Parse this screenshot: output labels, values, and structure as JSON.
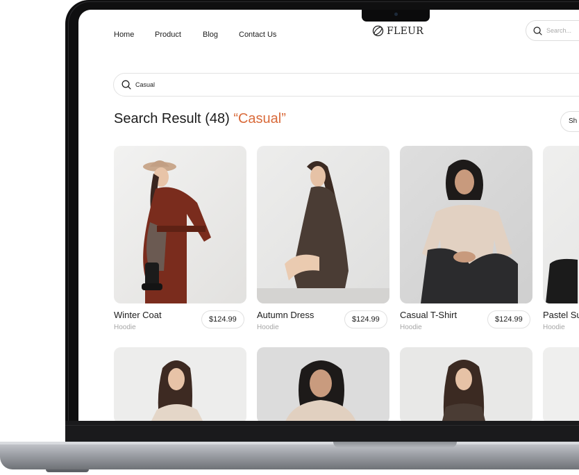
{
  "nav": {
    "links": [
      "Home",
      "Product",
      "Blog",
      "Contact Us"
    ],
    "logo": "FLEUR",
    "search_placeholder": "Search..."
  },
  "search": {
    "query": "Casual"
  },
  "results": {
    "label": "Search Result",
    "count": "(48)",
    "query_display": "“Casual”",
    "show_button": "Sh"
  },
  "products": [
    {
      "name": "Winter Coat",
      "category": "Hoodie",
      "price": "$124.99"
    },
    {
      "name": "Autumn Dress",
      "category": "Hoodie",
      "price": "$124.99"
    },
    {
      "name": "Casual T-Shirt",
      "category": "Hoodie",
      "price": "$124.99"
    },
    {
      "name": "Pastel Su",
      "category": "Hoodie",
      "price": ""
    }
  ],
  "colors": {
    "accent": "#d96a3a",
    "text": "#1c1c1c",
    "muted": "#a5a5a5",
    "bezel": "#0f0f10"
  },
  "icons": {
    "search": "search-icon",
    "logo": "logo-mark-icon"
  }
}
